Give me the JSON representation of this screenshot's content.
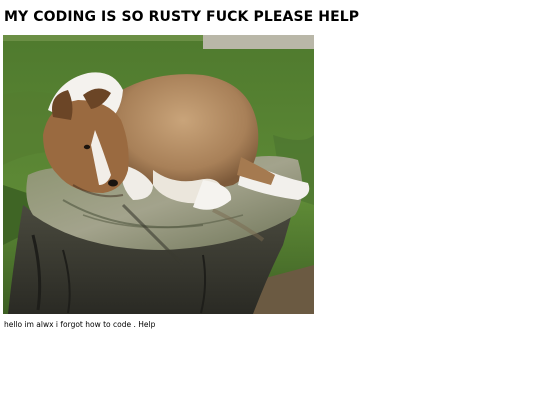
{
  "page": {
    "title": "MY CODING IS SO RUSTY FUCK PLEASE HELP",
    "caption": "hello im alwx i forgot how to code . Help"
  },
  "image": {
    "subject": "puppy-on-tree-stump"
  },
  "colors": {
    "background": "#ffffff",
    "text": "#000000"
  }
}
